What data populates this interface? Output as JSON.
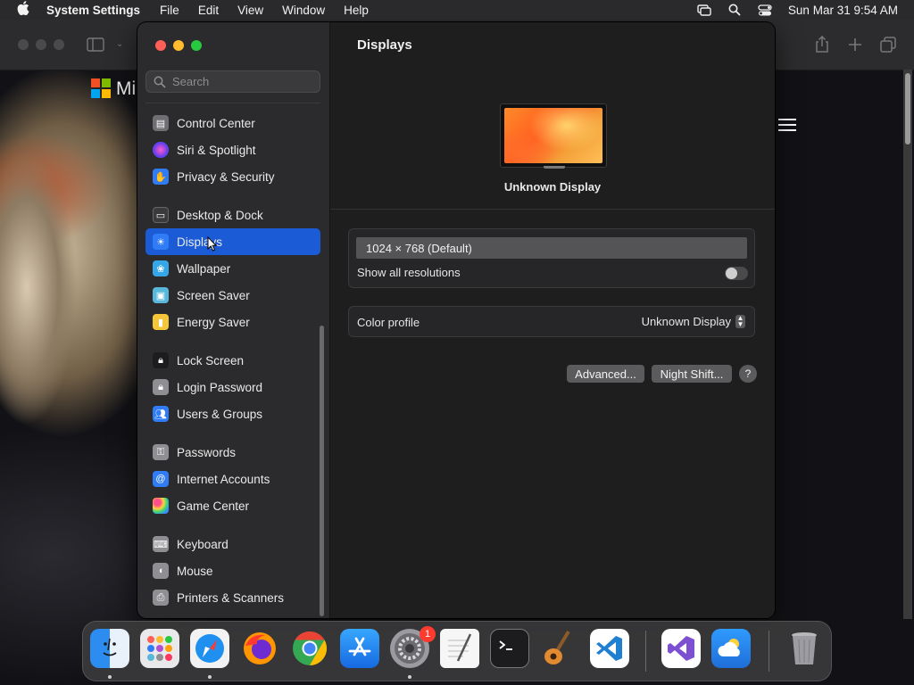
{
  "menubar": {
    "apple": "",
    "app_name": "System Settings",
    "menus": [
      "File",
      "Edit",
      "View",
      "Window",
      "Help"
    ],
    "datetime": "Sun Mar 31  9:54 AM",
    "icons": [
      "screen-mirroring-icon",
      "spotlight-search-icon",
      "control-center-icon"
    ]
  },
  "background": {
    "brand_text": "Mi",
    "brand_colors": [
      "#f25022",
      "#7fba00",
      "#00a4ef",
      "#ffb900"
    ]
  },
  "sidebar": {
    "search_placeholder": "Search",
    "items": [
      {
        "label": "Control Center",
        "icon": "control-center-icon",
        "color": "#6e6e73"
      },
      {
        "label": "Siri & Spotlight",
        "icon": "siri-icon",
        "color": "#b34fd1"
      },
      {
        "label": "Privacy & Security",
        "icon": "hand-icon",
        "color": "#2f7cf6"
      },
      {
        "label": "Desktop & Dock",
        "icon": "dock-icon",
        "color": "#3a3a3c"
      },
      {
        "label": "Displays",
        "icon": "sun-icon",
        "color": "#2f7cf6",
        "selected": true
      },
      {
        "label": "Wallpaper",
        "icon": "wallpaper-icon",
        "color": "#35a6e8"
      },
      {
        "label": "Screen Saver",
        "icon": "screen-saver-icon",
        "color": "#59b8d9"
      },
      {
        "label": "Energy Saver",
        "icon": "battery-icon",
        "color": "#f5c53a"
      },
      {
        "label": "Lock Screen",
        "icon": "lock-icon",
        "color": "#1c1c1e"
      },
      {
        "label": "Login Password",
        "icon": "lock-icon",
        "color": "#8e8e93"
      },
      {
        "label": "Users & Groups",
        "icon": "users-icon",
        "color": "#2f7cf6"
      },
      {
        "label": "Passwords",
        "icon": "key-icon",
        "color": "#8e8e93"
      },
      {
        "label": "Internet Accounts",
        "icon": "at-icon",
        "color": "#2f7cf6"
      },
      {
        "label": "Game Center",
        "icon": "game-center-icon",
        "color": "#ffffff"
      },
      {
        "label": "Keyboard",
        "icon": "keyboard-icon",
        "color": "#8e8e93"
      },
      {
        "label": "Mouse",
        "icon": "mouse-icon",
        "color": "#8e8e93"
      },
      {
        "label": "Printers & Scanners",
        "icon": "printer-icon",
        "color": "#8e8e93"
      }
    ]
  },
  "main": {
    "title": "Displays",
    "display_name": "Unknown Display",
    "resolution": "1024 × 768 (Default)",
    "show_all_label": "Show all resolutions",
    "show_all_on": false,
    "color_profile_label": "Color profile",
    "color_profile_value": "Unknown Display",
    "advanced_label": "Advanced...",
    "night_shift_label": "Night Shift...",
    "help_label": "?"
  },
  "dock": {
    "apps": [
      "Finder",
      "Launchpad",
      "Safari",
      "Firefox",
      "Chrome",
      "App Store",
      "System Settings",
      "TextEdit",
      "Terminal",
      "GarageBand",
      "Visual Studio Code",
      "Visual Studio",
      "Weather",
      "Trash"
    ],
    "settings_badge": "1"
  },
  "colors": {
    "accent": "#1c5bd6",
    "window_bg": "#1e1e1e",
    "sidebar_bg": "#2b2a2c"
  }
}
